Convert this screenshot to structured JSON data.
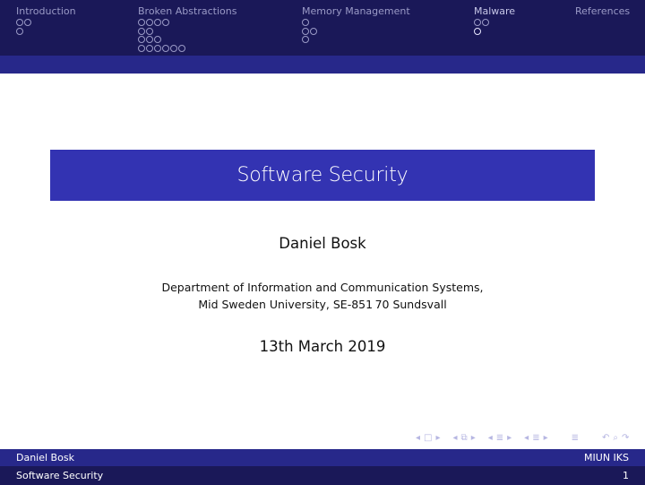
{
  "headline": {
    "sections": [
      {
        "title": "Introduction",
        "rows": [
          2,
          1
        ],
        "current": null
      },
      {
        "title": "Broken Abstractions",
        "rows": [
          4,
          2,
          3,
          6
        ],
        "current": null
      },
      {
        "title": "Memory Management",
        "rows": [
          1,
          2,
          1
        ],
        "current": null
      },
      {
        "title": "Malware",
        "rows": [
          2,
          1
        ],
        "current": [
          1,
          0
        ]
      },
      {
        "title": "References",
        "rows": [],
        "current": null
      }
    ]
  },
  "title_page": {
    "title": "Software Security",
    "author": "Daniel Bosk",
    "institute_line1": "Department of Information and Communication Systems,",
    "institute_line2": "Mid Sweden University, SE-851 70 Sundsvall",
    "date": "13th March 2019"
  },
  "nav_symbols": {
    "frame_prev": "◂",
    "frame_icon": "□",
    "frame_next": "▸",
    "subsection_prev": "◂",
    "subsection_icon": "⧉",
    "subsection_next": "▸",
    "section_prev": "◂",
    "section_icon": "≣",
    "section_next": "▸",
    "slide_prev": "◂",
    "slide_icon": "≣",
    "slide_next": "▸",
    "doc_icon": "≣",
    "back_icon": "↶",
    "search_icon": "⌕",
    "forward_icon": "↷"
  },
  "footer": {
    "author": "Daniel Bosk",
    "institute_short": "MIUN IKS",
    "title_short": "Software Security",
    "page_number": "1"
  },
  "colors": {
    "header_dark": "#1a1858",
    "header_light": "#27288a",
    "title_box": "#3333b2",
    "nav_text": "#9a9ac6"
  }
}
